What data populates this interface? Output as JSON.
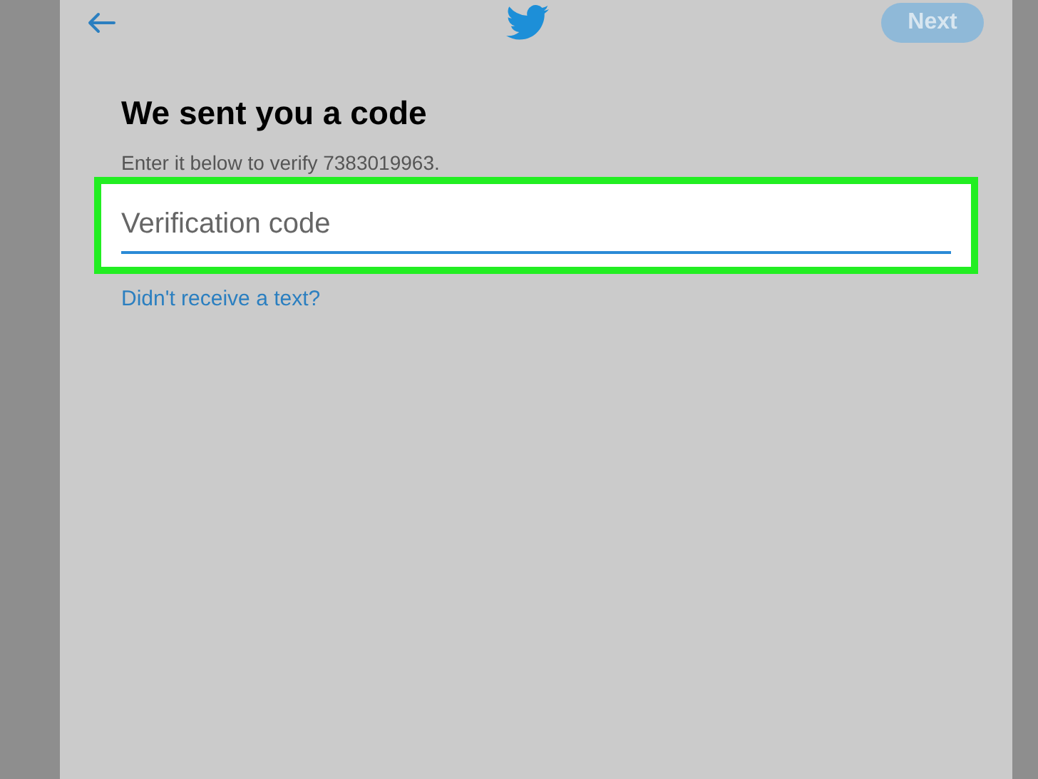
{
  "header": {
    "next_button": {
      "label": "Next",
      "disabled": true
    }
  },
  "title": "We sent you a code",
  "subtitle": "Enter it below to verify 7383019963.",
  "code_field": {
    "placeholder": "Verification code",
    "highlighted": true
  },
  "resend_link": "Didn't receive a text?"
}
